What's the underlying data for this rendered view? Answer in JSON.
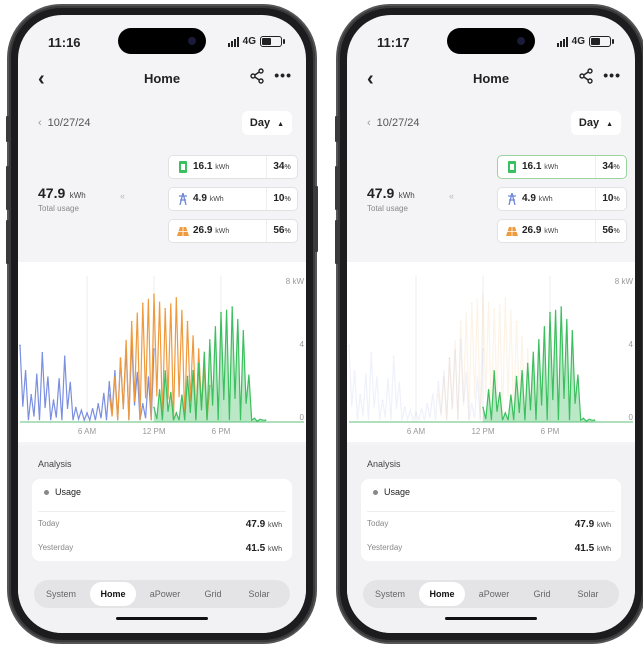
{
  "phones": [
    {
      "status": {
        "time": "11:16",
        "network": "4G"
      },
      "nav": {
        "back": "‹",
        "title": "Home",
        "more": "•••"
      },
      "date_label": "10/27/24",
      "period": "Day",
      "total": {
        "value": "47.9",
        "unit": "kWh",
        "label": "Total usage"
      },
      "sources": [
        {
          "name": "battery",
          "value": "16.1",
          "unit": "kWh",
          "pct": "34",
          "pct_unit": "%",
          "selected": false
        },
        {
          "name": "grid",
          "value": "4.9",
          "unit": "kWh",
          "pct": "10",
          "pct_unit": "%",
          "selected": false
        },
        {
          "name": "solar",
          "value": "26.9",
          "unit": "kWh",
          "pct": "56",
          "pct_unit": "%",
          "selected": false
        }
      ],
      "chart_highlight": "all",
      "analysis": {
        "title": "Analysis",
        "legend": "Usage",
        "rows": [
          {
            "k": "Today",
            "v": "47.9",
            "unit": "kWh"
          },
          {
            "k": "Yesterday",
            "v": "41.5",
            "unit": "kWh"
          }
        ]
      },
      "tabs": [
        "System",
        "Home",
        "aPower",
        "Grid",
        "Solar"
      ],
      "active_tab": "Home"
    },
    {
      "status": {
        "time": "11:17",
        "network": "4G"
      },
      "nav": {
        "back": "‹",
        "title": "Home",
        "more": "•••"
      },
      "date_label": "10/27/24",
      "period": "Day",
      "total": {
        "value": "47.9",
        "unit": "kWh",
        "label": "Total usage"
      },
      "sources": [
        {
          "name": "battery",
          "value": "16.1",
          "unit": "kWh",
          "pct": "34",
          "pct_unit": "%",
          "selected": true
        },
        {
          "name": "grid",
          "value": "4.9",
          "unit": "kWh",
          "pct": "10",
          "pct_unit": "%",
          "selected": false
        },
        {
          "name": "solar",
          "value": "26.9",
          "unit": "kWh",
          "pct": "56",
          "pct_unit": "%",
          "selected": false
        }
      ],
      "chart_highlight": "battery",
      "analysis": {
        "title": "Analysis",
        "legend": "Usage",
        "rows": [
          {
            "k": "Today",
            "v": "47.9",
            "unit": "kWh"
          },
          {
            "k": "Yesterday",
            "v": "41.5",
            "unit": "kWh"
          }
        ]
      },
      "tabs": [
        "System",
        "Home",
        "aPower",
        "Grid",
        "Solar"
      ],
      "active_tab": "Home"
    }
  ],
  "chart_data": {
    "type": "area",
    "x_ticks": [
      "6 AM",
      "12 PM",
      "6 PM"
    ],
    "y_ticks": [
      "0",
      "4",
      "8 kW"
    ],
    "ylim": [
      0,
      8
    ],
    "x_range_hours": [
      0,
      24
    ],
    "series": [
      {
        "color": "#7b8fe0",
        "x": [
          0,
          1,
          2,
          3,
          4,
          5,
          6,
          7,
          8,
          9,
          10,
          11,
          12
        ],
        "values": [
          4.2,
          1.5,
          3.8,
          1.2,
          3.6,
          0.8,
          0.5,
          1.0,
          2.2,
          3.5,
          4.5,
          1.0,
          4.0
        ]
      },
      {
        "color": "#ef9a3c",
        "x": [
          8,
          9,
          10,
          11,
          12,
          13,
          14,
          15,
          16,
          17
        ],
        "values": [
          1.5,
          3.5,
          5.5,
          6.5,
          7.0,
          6.2,
          6.8,
          5.5,
          4.0,
          2.0
        ]
      },
      {
        "color": "#3cbf5e",
        "x": [
          12,
          13,
          14,
          15,
          16,
          17,
          18,
          19,
          20,
          21,
          22
        ],
        "values": [
          0.8,
          2.8,
          0.5,
          2.5,
          3.2,
          4.5,
          6.0,
          6.3,
          5.0,
          0.2,
          0.1
        ]
      }
    ]
  },
  "colors": {
    "battery": "#3cbf5e",
    "grid": "#6f87d8",
    "solar": "#ef9a3c",
    "selected_border": "#9ad3a0"
  }
}
